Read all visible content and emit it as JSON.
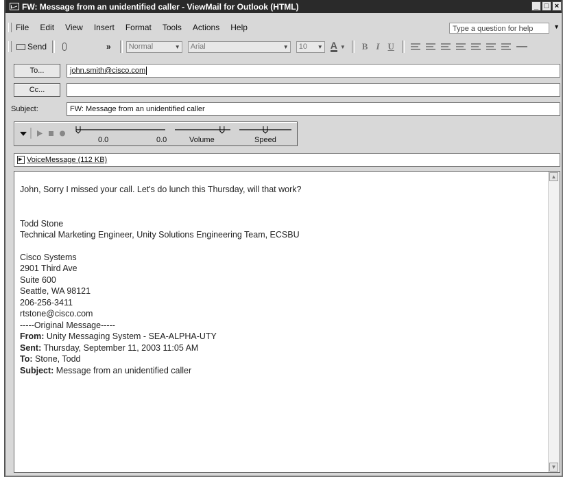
{
  "window": {
    "title": "FW: Message from an unidentified caller - ViewMail for Outlook (HTML)",
    "controls": [
      "_",
      "□",
      "×"
    ]
  },
  "menu": [
    "File",
    "Edit",
    "View",
    "Insert",
    "Format",
    "Tools",
    "Actions",
    "Help"
  ],
  "ask_question": "Type a question for help",
  "toolbar": {
    "send_label": "Send",
    "style_value": "Normal",
    "font_value": "Arial",
    "size_value": "10",
    "chevron": "»"
  },
  "header": {
    "to_label": "To...",
    "to_value": "john.smith@cisco.com",
    "cc_label": "Cc...",
    "cc_value": "",
    "subject_label": "Subject:",
    "subject_value": "FW: Message from an unidentified caller"
  },
  "player": {
    "position": "0.0",
    "duration": "0.0",
    "volume_label": "Volume",
    "speed_label": "Speed",
    "volume_level": 0.85,
    "speed_level": 0.5
  },
  "attachment": "VoiceMessage (112 KB)",
  "message": {
    "greeting": "John, Sorry I missed your call. Let's do lunch this Thursday, will that work?",
    "signature": [
      "Todd Stone",
      "Technical Marketing Engineer, Unity Solutions Engineering Team, ECSBU"
    ],
    "address": [
      "Cisco Systems",
      "2901 Third Ave",
      "Suite 600",
      "Seattle, WA 98121",
      "206-256-3411",
      "rtstone@cisco.com"
    ],
    "original_separator": "-----Original Message-----",
    "original": [
      {
        "label": "From:",
        "value": "Unity Messaging System - SEA-ALPHA-UTY"
      },
      {
        "label": "Sent:",
        "value": "Thursday, September 11, 2003 11:05 AM"
      },
      {
        "label": "To:",
        "value": "Stone, Todd"
      },
      {
        "label": "Subject:",
        "value": "Message from an unidentified caller"
      }
    ]
  }
}
